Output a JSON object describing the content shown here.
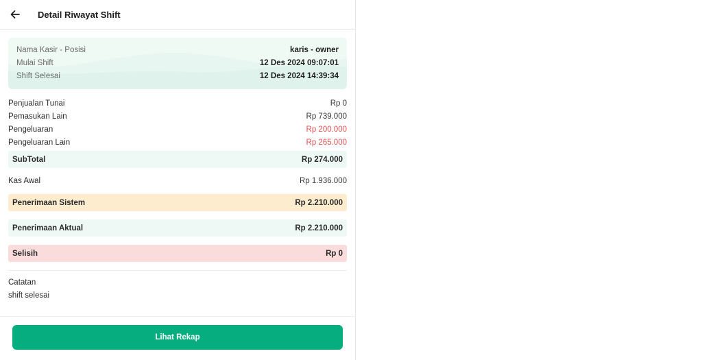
{
  "header": {
    "title": "Detail Riwayat Shift"
  },
  "info": {
    "rows": [
      {
        "label": "Nama Kasir - Posisi",
        "value": "karis - owner"
      },
      {
        "label": "Mulai Shift",
        "value": "12 Des 2024 09:07:01"
      },
      {
        "label": "Shift Selesai",
        "value": "12 Des 2024 14:39:34"
      }
    ]
  },
  "summary": [
    {
      "label": "Penjualan Tunai",
      "value": "Rp 0"
    },
    {
      "label": "Pemasukan Lain",
      "value": "Rp 739.000"
    },
    {
      "label": "Pengeluaran",
      "value": "Rp 200.000"
    },
    {
      "label": "Pengeluaran Lain",
      "value": "Rp 265.000"
    }
  ],
  "subtotal": {
    "label": "SubTotal",
    "value": "Rp 274.000"
  },
  "kas_awal": {
    "label": "Kas Awal",
    "value": "Rp 1.936.000"
  },
  "penerimaan_sistem": {
    "label": "Penerimaan Sistem",
    "value": "Rp 2.210.000"
  },
  "penerimaan_aktual": {
    "label": "Penerimaan Aktual",
    "value": "Rp 2.210.000"
  },
  "selisih": {
    "label": "Selisih",
    "value": "Rp 0"
  },
  "notes": {
    "label": "Catatan",
    "value": "shift selesai"
  },
  "footer": {
    "button_label": "Lihat Rekap"
  },
  "colors": {
    "primary": "#06ad7e",
    "negative": "#e45454",
    "card_bg": "#dff3ec",
    "band_green": "#eef8f4",
    "band_yellow": "#fdeccd",
    "band_red": "#fbdcdc"
  },
  "icons": {
    "back": "arrow-left-icon"
  }
}
